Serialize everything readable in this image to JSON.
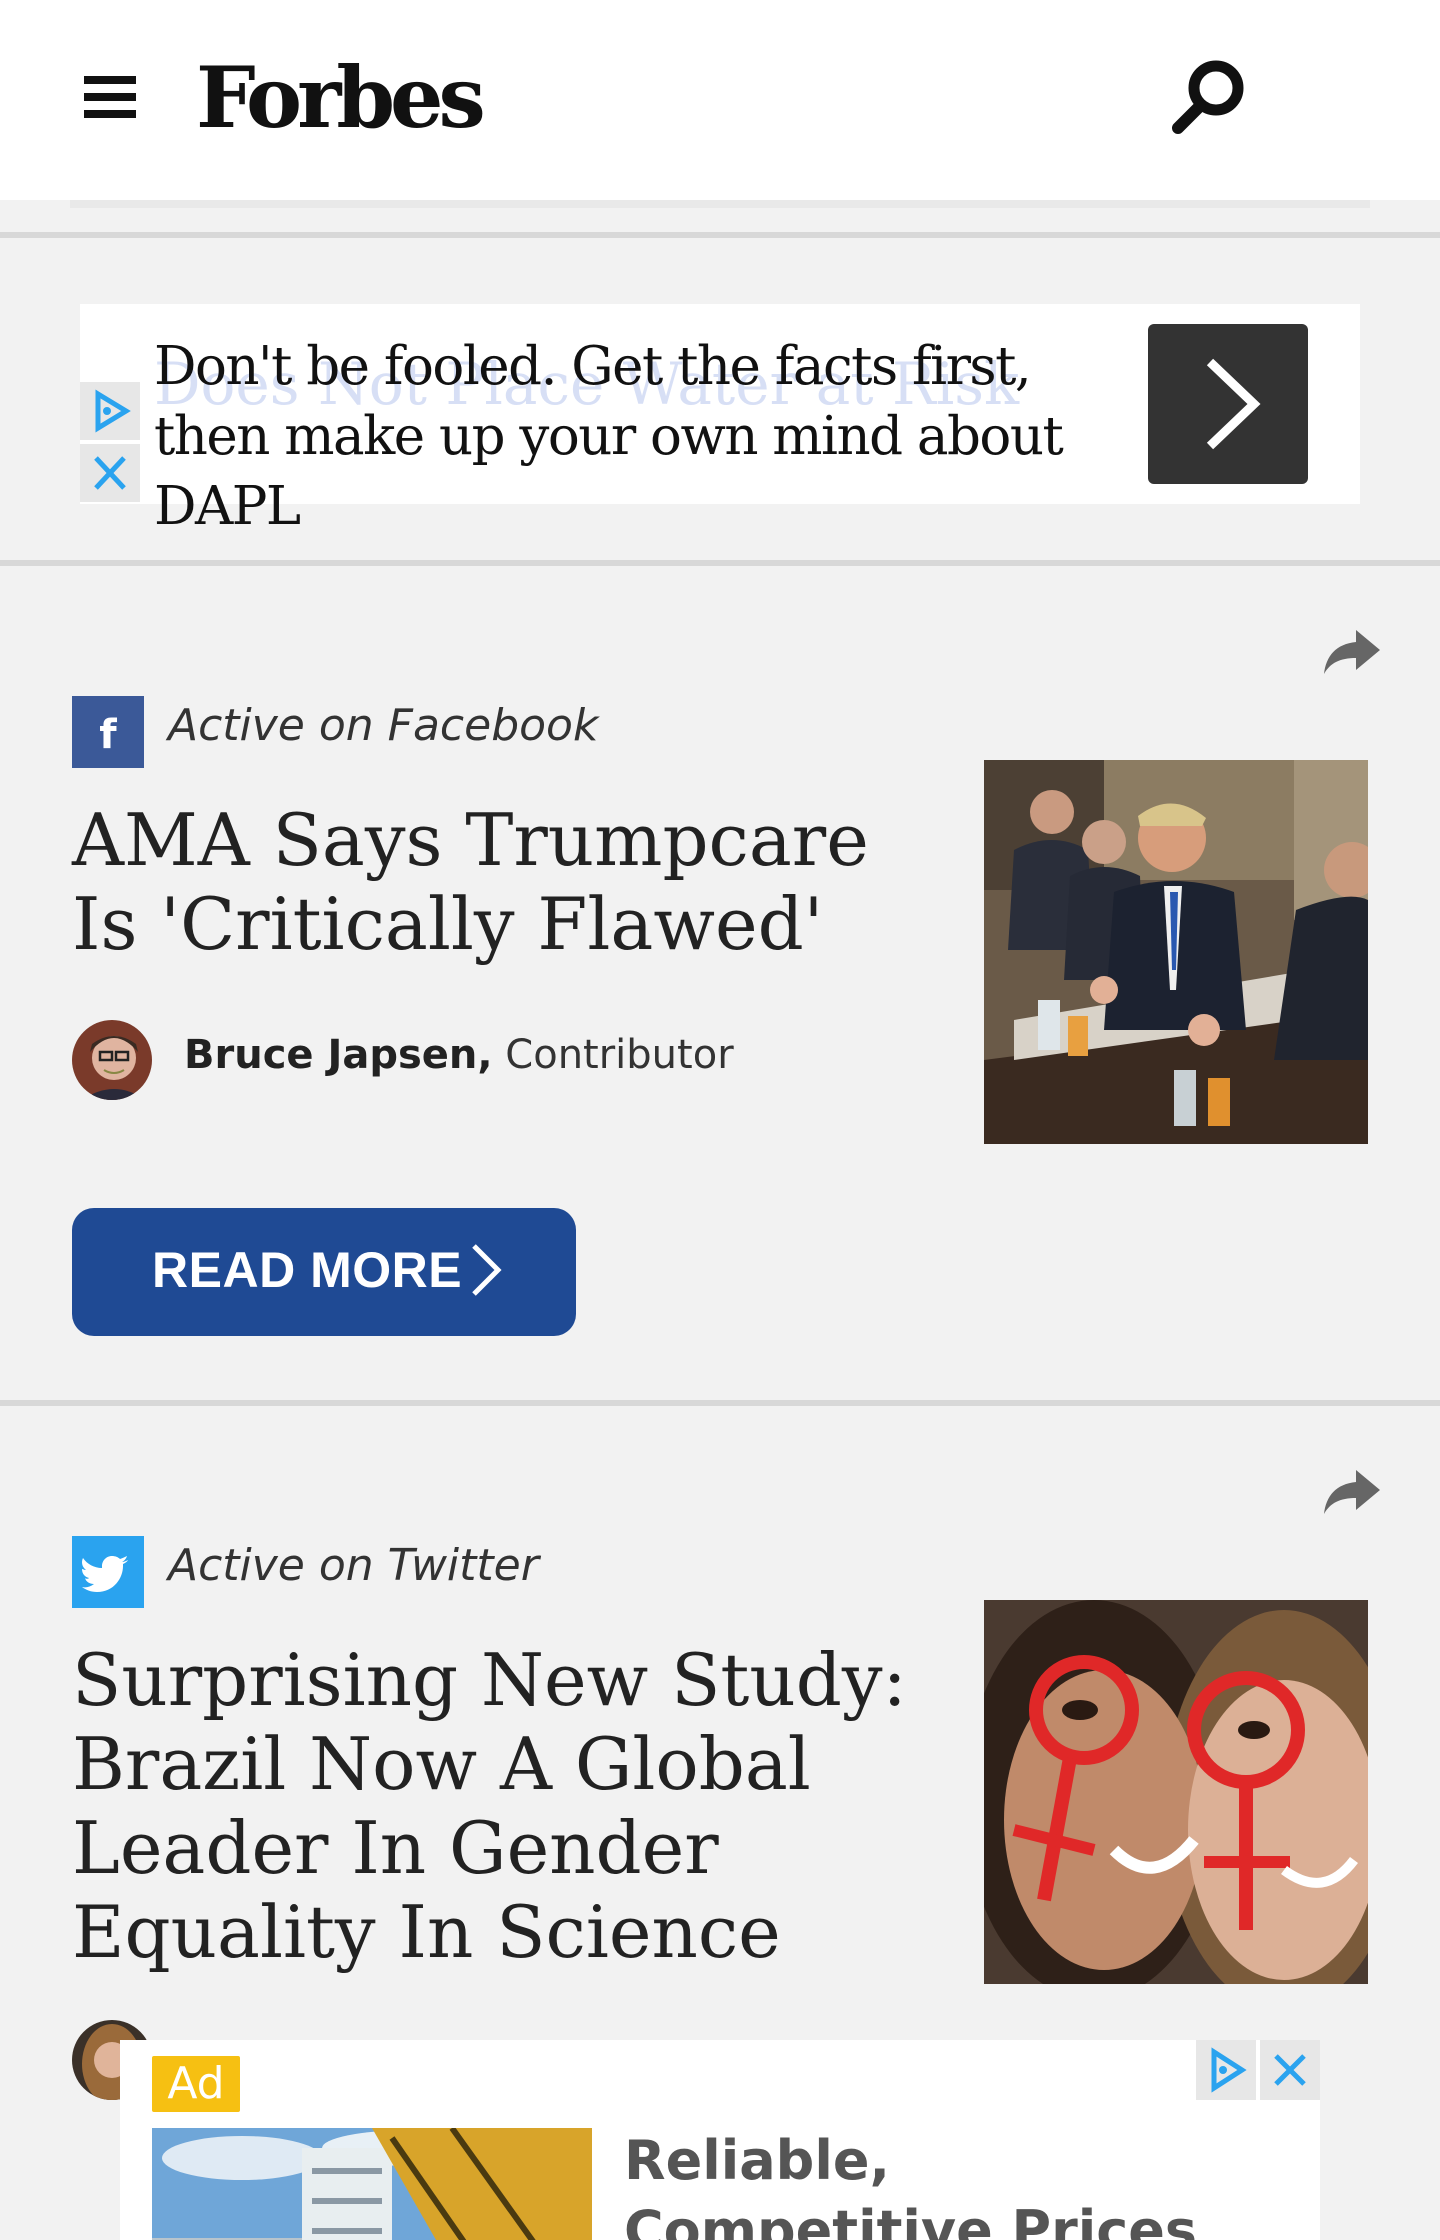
{
  "header": {
    "logo": "Forbes"
  },
  "ad_banner": {
    "text": "Don't be fooled. Get the facts first, then make up your own mind about DAPL",
    "ghost_text": "Does Not Place Water at Risk"
  },
  "articles": [
    {
      "source_label": "Active on Facebook",
      "headline": "AMA Says Trumpcare Is 'Critically Flawed'",
      "author": "Bruce Japsen,",
      "author_role": "Contributor",
      "cta": "READ MORE"
    },
    {
      "source_label": "Active on Twitter",
      "headline": "Surprising New Study: Brazil Now A Global Leader In Gender Equality In Science"
    }
  ],
  "bottom_ad": {
    "tag": "Ad",
    "title": "Reliable, Competitive Prices"
  },
  "colors": {
    "facebook": "#3b5998",
    "twitter": "#2aa3ef",
    "read_more": "#1f4a94",
    "ad_tag": "#f6c012",
    "adchoices": "#2aa3ef"
  },
  "icons": [
    "menu-icon",
    "search-icon",
    "share-icon",
    "facebook-icon",
    "twitter-icon",
    "adchoices-icon",
    "close-icon",
    "chevron-right-icon"
  ]
}
